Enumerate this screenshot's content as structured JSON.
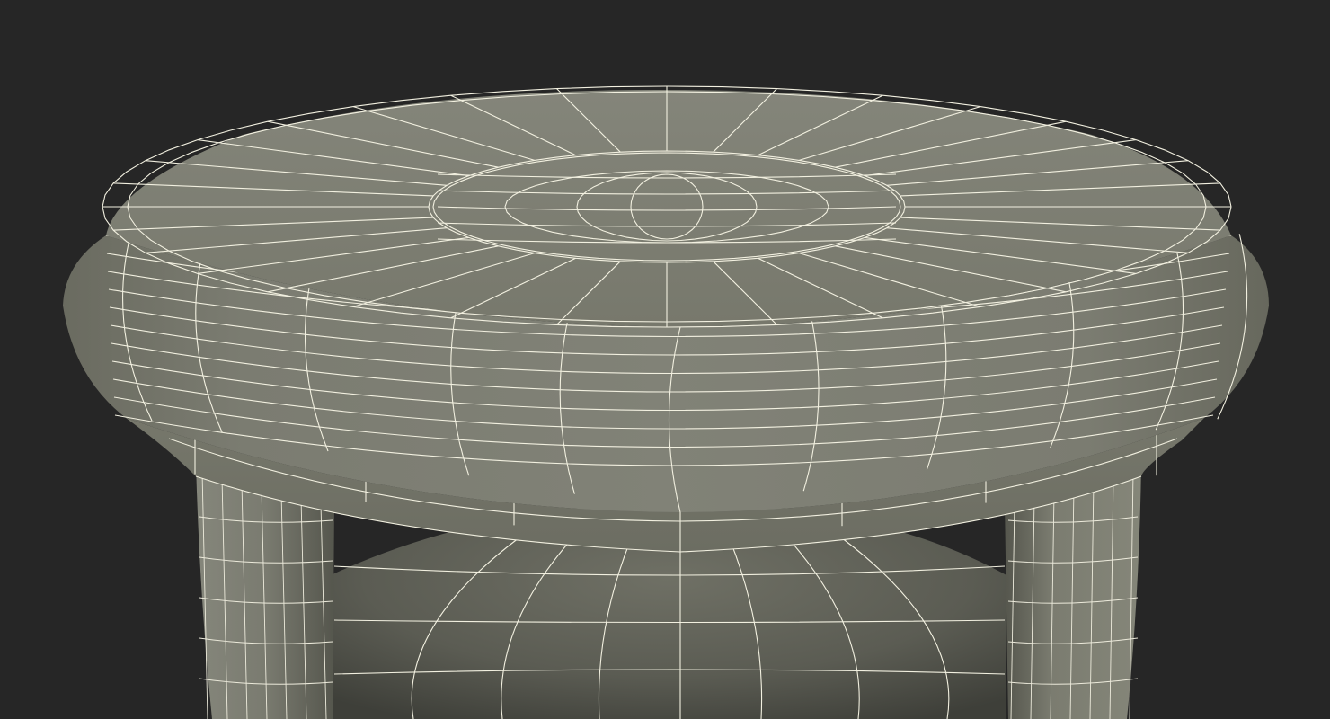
{
  "viewport": {
    "background_color": "#262626"
  },
  "model": {
    "subject": "stool",
    "shading": "wireframe-on-shaded",
    "surface_color": "#7a7b6e",
    "surface_shadow_color": "#4f5048",
    "wire_color": "#f2f0e0",
    "parts": [
      "seat-top",
      "seat-rim",
      "seat-skirt",
      "leg-left",
      "leg-right",
      "center-bowl"
    ]
  }
}
